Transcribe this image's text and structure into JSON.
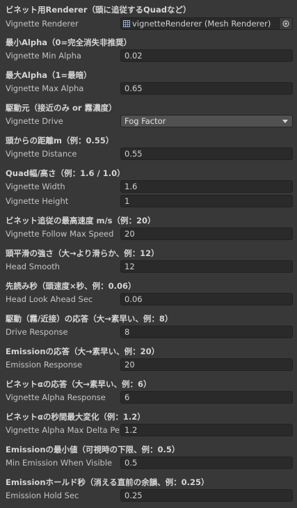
{
  "sections": {
    "renderer": {
      "header": "ビネット用Renderer（頭に追従するQuadなど）",
      "label": "Vignette Renderer",
      "value": "vignetteRenderer (Mesh Renderer)",
      "icon": "mesh-renderer-icon",
      "picker_icon": "object-picker-icon"
    },
    "min_alpha": {
      "header": "最小Alpha（0=完全消失非推奨）",
      "label": "Vignette Min Alpha",
      "value": "0.02"
    },
    "max_alpha": {
      "header": "最大Alpha（1=最暗）",
      "label": "Vignette Max Alpha",
      "value": "0.65"
    },
    "drive": {
      "header": "駆動元（接近のみ or 霧濃度）",
      "label": "Vignette Drive",
      "value": "Fog Factor",
      "icon": "dropdown-arrow-icon"
    },
    "distance": {
      "header": "頭からの距離m（例：0.55）",
      "label": "Vignette Distance",
      "value": "0.55"
    },
    "quad_size": {
      "header": "Quad幅/高さ（例：1.6 / 1.0）",
      "width_label": "Vignette Width",
      "width_value": "1.6",
      "height_label": "Vignette Height",
      "height_value": "1"
    },
    "follow_speed": {
      "header": "ビネット追従の最高速度 m/s（例：20）",
      "label": "Vignette Follow Max Speed",
      "value": "20"
    },
    "head_smooth": {
      "header": "頭平滑の強さ（大→より滑らか、例：12）",
      "label": "Head Smooth",
      "value": "12"
    },
    "look_ahead": {
      "header": "先読み秒（頭速度×秒、例：0.06）",
      "label": "Head Look Ahead Sec",
      "value": "0.06"
    },
    "drive_response": {
      "header": "駆動（霧/近接）の応答（大→素早い、例：8）",
      "label": "Drive Response",
      "value": "8"
    },
    "emission_response": {
      "header": "Emissionの応答（大→素早い、例：20）",
      "label": "Emission Response",
      "value": "20"
    },
    "alpha_response": {
      "header": "ビネットαの応答（大→素早い、例：6）",
      "label": "Vignette Alpha Response",
      "value": "6"
    },
    "alpha_max_delta": {
      "header": "ビネットαの秒間最大変化（例：1.2）",
      "label": "Vignette Alpha Max Delta Per",
      "value": "1.2"
    },
    "min_emission": {
      "header": "Emissionの最小値（可視時の下限、例：0.5）",
      "label": "Min Emission When Visible",
      "value": "0.5"
    },
    "emission_hold": {
      "header": "Emissionホールド秒（消える直前の余韻、例：0.25）",
      "label": "Emission Hold Sec",
      "value": "0.25"
    }
  }
}
